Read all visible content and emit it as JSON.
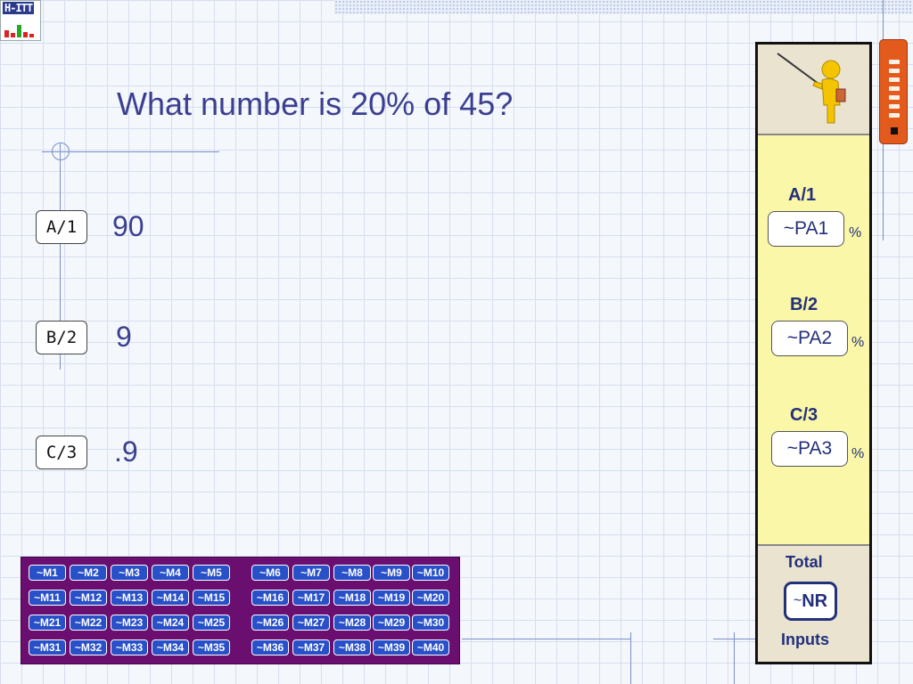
{
  "logo": {
    "text": "H-ITT"
  },
  "question": "What number is 20% of 45?",
  "options": [
    {
      "label": "A/1",
      "answer": "90"
    },
    {
      "label": "B/2",
      "answer": "9"
    },
    {
      "label": "C/3",
      "answer": ".9"
    }
  ],
  "panel": {
    "results": [
      {
        "label": "A/1",
        "value": "~PA1",
        "unit": "%"
      },
      {
        "label": "B/2",
        "value": "~PA2",
        "unit": "%"
      },
      {
        "label": "C/3",
        "value": "~PA3",
        "unit": "%"
      }
    ],
    "total_label": "Total",
    "total_value_prefix": "~",
    "total_value": "NR",
    "inputs_label": "Inputs"
  },
  "matrix": [
    [
      "~M1",
      "~M2",
      "~M3",
      "~M4",
      "~M5",
      "~M6",
      "~M7",
      "~M8",
      "~M9",
      "~M10"
    ],
    [
      "~M11",
      "~M12",
      "~M13",
      "~M14",
      "~M15",
      "~M16",
      "~M17",
      "~M18",
      "~M19",
      "~M20"
    ],
    [
      "~M21",
      "~M22",
      "~M23",
      "~M24",
      "~M25",
      "~M26",
      "~M27",
      "~M28",
      "~M29",
      "~M30"
    ],
    [
      "~M31",
      "~M32",
      "~M33",
      "~M34",
      "~M35",
      "~M36",
      "~M37",
      "~M38",
      "~M39",
      "~M40"
    ]
  ],
  "colors": {
    "accent": "#3b3f8f",
    "panel_bg": "#fbf7a8",
    "matrix_bg": "#6a0e6f",
    "matrix_button": "#2850c8",
    "remote": "#e25a1c"
  }
}
